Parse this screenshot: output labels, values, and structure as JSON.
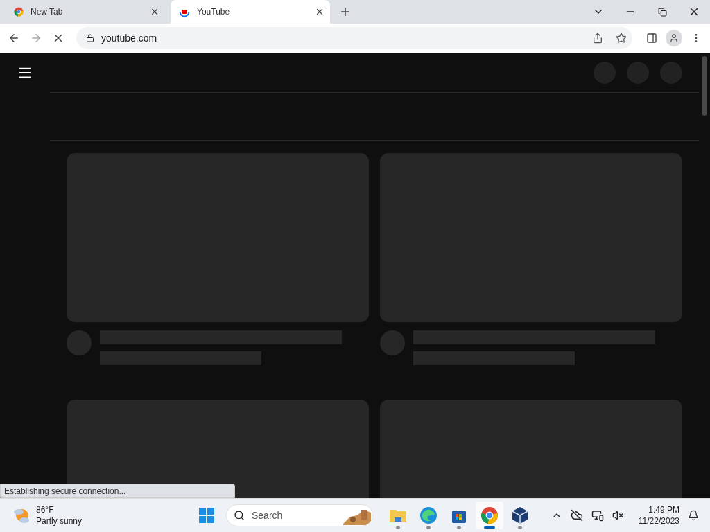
{
  "browser": {
    "tabs": [
      {
        "title": "New Tab",
        "kind": "chrome",
        "selected": false
      },
      {
        "title": "YouTube",
        "kind": "youtube",
        "selected": true
      }
    ],
    "address": "youtube.com",
    "loading": true
  },
  "page": {
    "feed": [
      {
        "kind": "skeleton"
      },
      {
        "kind": "skeleton"
      },
      {
        "kind": "thumbnail_only"
      },
      {
        "kind": "thumbnail_only"
      }
    ]
  },
  "status_bubble": "Establishing secure connection...",
  "taskbar": {
    "weather": {
      "temperature": "86°F",
      "condition": "Partly sunny"
    },
    "search": {
      "placeholder": "Search"
    },
    "apps": [
      {
        "kind": "explorer",
        "selected": false
      },
      {
        "kind": "edge",
        "selected": false
      },
      {
        "kind": "store",
        "selected": false
      },
      {
        "kind": "chrome",
        "selected": true
      },
      {
        "kind": "virtualbox",
        "selected": false
      }
    ],
    "time": "1:49 PM",
    "date": "11/22/2023"
  }
}
